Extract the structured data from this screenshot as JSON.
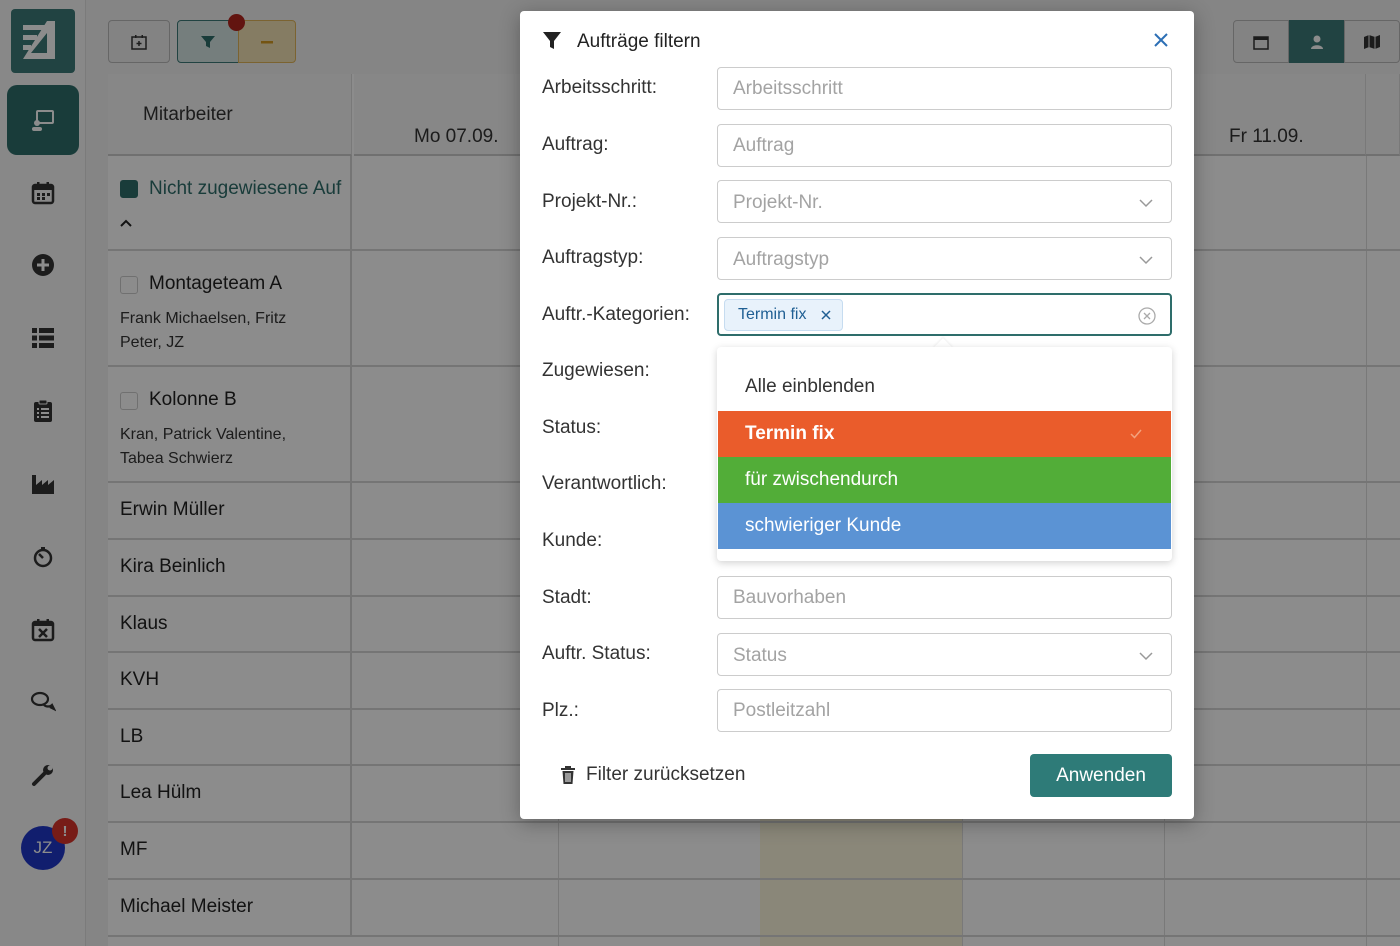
{
  "toolbar": {
    "filter_active": true
  },
  "grid": {
    "employee_header": "Mitarbeiter",
    "days": [
      "Mo 07.09.",
      "Fr 11.09."
    ],
    "unassigned_label": "Nicht zugewiesene Auf",
    "rows": [
      {
        "name": "Montageteam A",
        "members": "Frank Michaelsen, Fritz Peter, JZ"
      },
      {
        "name": "Kolonne B",
        "members": "Kran, Patrick Valentine, Tabea Schwierz"
      },
      {
        "name": "Erwin Müller"
      },
      {
        "name": "Kira Beinlich"
      },
      {
        "name": "Klaus"
      },
      {
        "name": "KVH"
      },
      {
        "name": "LB"
      },
      {
        "name": "Lea Hülm"
      },
      {
        "name": "MF"
      },
      {
        "name": "Michael Meister"
      }
    ]
  },
  "user": {
    "initials": "JZ",
    "badge": "!"
  },
  "modal": {
    "title": "Aufträge filtern",
    "fields": {
      "arbeitsschritt": {
        "label": "Arbeitsschritt:",
        "placeholder": "Arbeitsschritt"
      },
      "auftrag": {
        "label": "Auftrag:",
        "placeholder": "Auftrag"
      },
      "projekt": {
        "label": "Projekt-Nr.:",
        "placeholder": "Projekt-Nr."
      },
      "auftragstyp": {
        "label": "Auftragstyp:",
        "placeholder": "Auftragstyp"
      },
      "kategorien": {
        "label": "Auftr.-Kategorien:",
        "selected_tag": "Termin fix"
      },
      "zugewiesen": {
        "label": "Zugewiesen:"
      },
      "status": {
        "label": "Status:"
      },
      "verantwortlich": {
        "label": "Verantwortlich:"
      },
      "kunde": {
        "label": "Kunde:"
      },
      "stadt": {
        "label": "Stadt:",
        "placeholder": "Bauvorhaben"
      },
      "auftr_status": {
        "label": "Auftr. Status:",
        "placeholder": "Status"
      },
      "plz": {
        "label": "Plz.:",
        "placeholder": "Postleitzahl"
      }
    },
    "dropdown": {
      "show_all": "Alle einblenden",
      "options": [
        {
          "label": "Termin fix",
          "color": "#ea5c2b",
          "selected": true
        },
        {
          "label": "für zwischendurch",
          "color": "#52ad38",
          "selected": false
        },
        {
          "label": "schwieriger Kunde",
          "color": "#5b93d4",
          "selected": false
        }
      ]
    },
    "reset_label": "Filter zurücksetzen",
    "apply_label": "Anwenden"
  },
  "colors": {
    "accent": "#2e7b78",
    "brand": "#3d7a78"
  }
}
